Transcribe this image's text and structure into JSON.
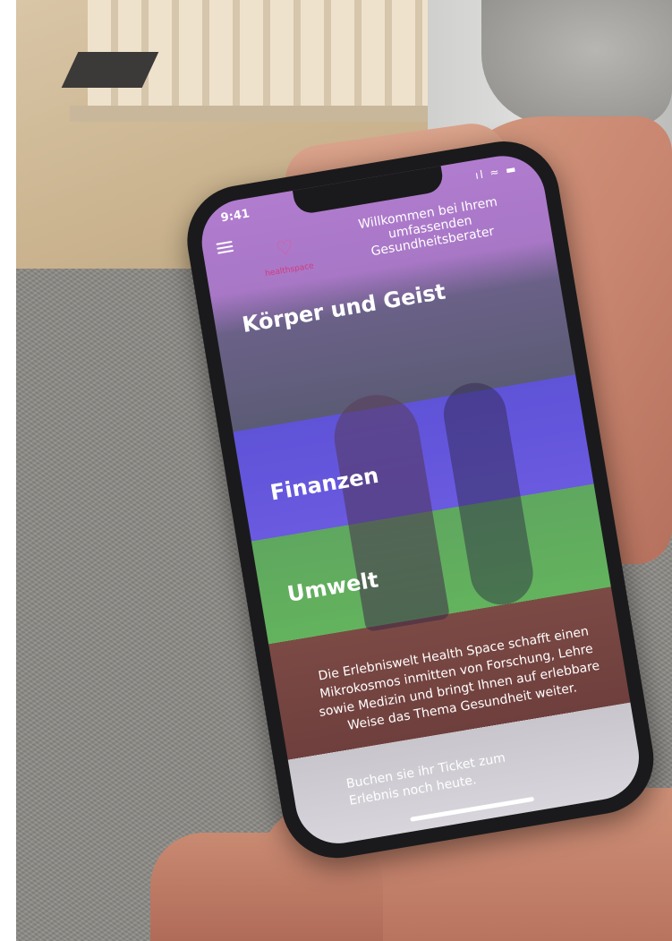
{
  "status_bar": {
    "time": "9:41",
    "icons": "ıl ≈ ▬"
  },
  "header": {
    "logo_text": "healthspace",
    "logo_heart": "♡",
    "welcome": "Willkommen bei Ihrem umfassenden Gesundheitsberater"
  },
  "sections": [
    {
      "label": "Körper und Geist",
      "color": "#5b5b75"
    },
    {
      "label": "Finanzen",
      "color": "#6a5ae0"
    },
    {
      "label": "Umwelt",
      "color": "#63b35e"
    }
  ],
  "description": "Die Erlebniswelt Health Space schafft einen Mikrokosmos inmitten von Forschung, Lehre sowie Medizin und bringt Ihnen auf erlebbare Weise das Thema Gesundheit weiter.",
  "cta": "Buchen sie ihr Ticket zum Erlebnis noch heute.",
  "colors": {
    "header": "#b17ccf",
    "description_bg": "#6e3f3d",
    "logo": "#d33b7e"
  }
}
